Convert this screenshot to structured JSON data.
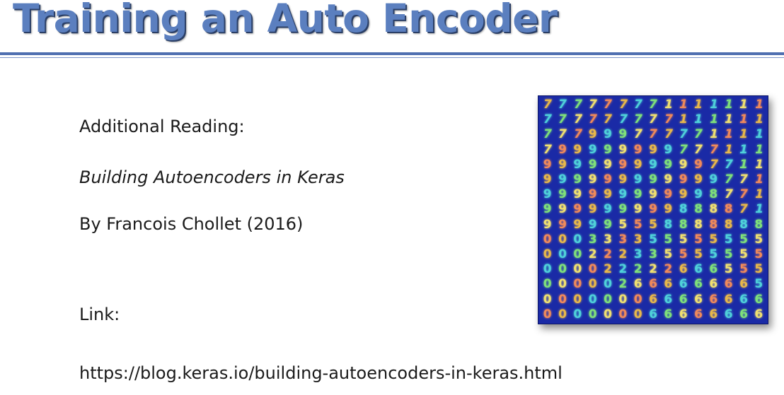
{
  "slide": {
    "title": "Training an Auto Encoder",
    "additional_reading_label": "Additional Reading:",
    "article_title": "Building Autoencoders in Keras",
    "byline": "By Francois Chollet (2016)",
    "link_label": "Link:",
    "link_url": "https://blog.keras.io/building-autoencoders-in-keras.html"
  },
  "colors": {
    "title": "#5b7fbf",
    "rule": "#4f6fb0",
    "figure_background": "#1a2aa6"
  },
  "figure": {
    "rows": [
      "777777771111111",
      "777777777111111",
      "777999777771111",
      "799999999777111",
      "999999999997711",
      "999999999999771",
      "999999999998771",
      "999999999888871",
      "999995558888888",
      "000333355555555",
      "000222335555555",
      "000022222666555",
      "000002666666665",
      "000000066666666",
      "000000066666666"
    ],
    "glyph_colors": [
      "#e8b84a",
      "#4fd1d9",
      "#7fe07a",
      "#f0e070",
      "#f08a5a"
    ]
  }
}
